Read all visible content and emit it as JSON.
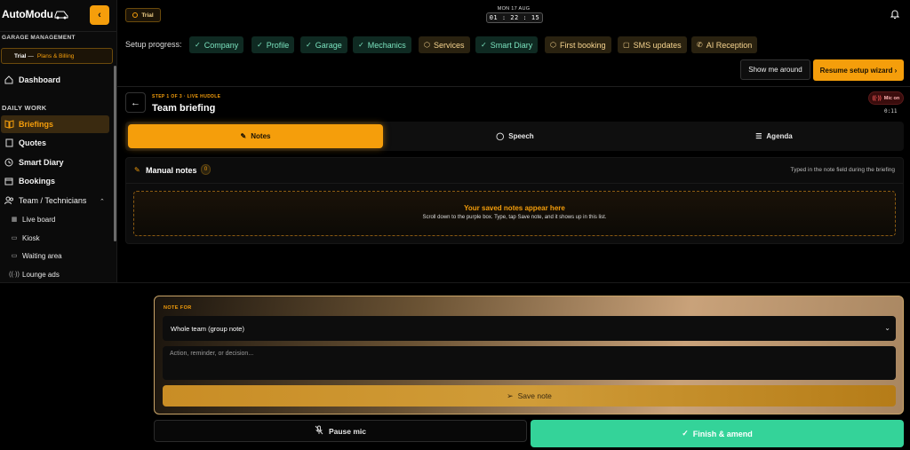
{
  "brand": {
    "name": "AutoModu"
  },
  "sidebar": {
    "section_garage": "GARAGE MANAGEMENT",
    "trial": {
      "label": "Trial",
      "sep": "—",
      "plans": "Plans & Billing"
    },
    "dashboard": "Dashboard",
    "section_daily": "DAILY WORK",
    "items": [
      {
        "label": "Briefings",
        "icon": "book-icon"
      },
      {
        "label": "Quotes",
        "icon": "document-icon"
      },
      {
        "label": "Smart Diary",
        "icon": "clock-icon"
      },
      {
        "label": "Bookings",
        "icon": "calendar-icon"
      },
      {
        "label": "Team / Technicians",
        "icon": "users-icon"
      }
    ],
    "sub_items": [
      {
        "label": "Live board",
        "icon": "grid-icon"
      },
      {
        "label": "Kiosk",
        "icon": "monitor-icon"
      },
      {
        "label": "Waiting area",
        "icon": "monitor-icon"
      },
      {
        "label": "Lounge ads",
        "icon": "broadcast-icon"
      }
    ]
  },
  "topbar": {
    "trial_badge": "Trial",
    "date": "MON 17 AUG",
    "time": "01 : 22 : 15"
  },
  "setup": {
    "label": "Setup progress:",
    "chips": [
      {
        "label": "Company",
        "status": "done"
      },
      {
        "label": "Profile",
        "status": "done"
      },
      {
        "label": "Garage",
        "status": "done"
      },
      {
        "label": "Mechanics",
        "status": "done"
      },
      {
        "label": "Services",
        "status": "todo"
      },
      {
        "label": "Smart Diary",
        "status": "done"
      },
      {
        "label": "First booking",
        "status": "todo"
      },
      {
        "label": "SMS updates",
        "status": "todo"
      },
      {
        "label": "AI Reception",
        "status": "todo"
      }
    ],
    "show_me_around": "Show me around",
    "resume": "Resume setup wizard ›"
  },
  "briefing": {
    "step": "STEP 1 OF 3 · LIVE HUDDLE",
    "title": "Team briefing",
    "mic_status": "Mic on",
    "timer": "0:11",
    "tabs": [
      "Notes",
      "Speech",
      "Agenda"
    ]
  },
  "notes": {
    "title": "Manual notes",
    "count": "0",
    "hint": "Typed in the note field during the briefing",
    "empty_title": "Your saved notes appear here",
    "empty_sub": "Scroll down to the purple box. Type, tap Save note, and it shows up in this list."
  },
  "note_form": {
    "label": "NOTE FOR",
    "select_value": "Whole team (group note)",
    "placeholder": "Action, reminder, or decision...",
    "save": "Save note"
  },
  "footer": {
    "pause": "Pause mic",
    "finish": "Finish & amend"
  },
  "colors": {
    "accent": "#f59e0b",
    "success": "#34d399",
    "done_chip": "#7be3bf",
    "todo_chip": "#f6d48f"
  }
}
